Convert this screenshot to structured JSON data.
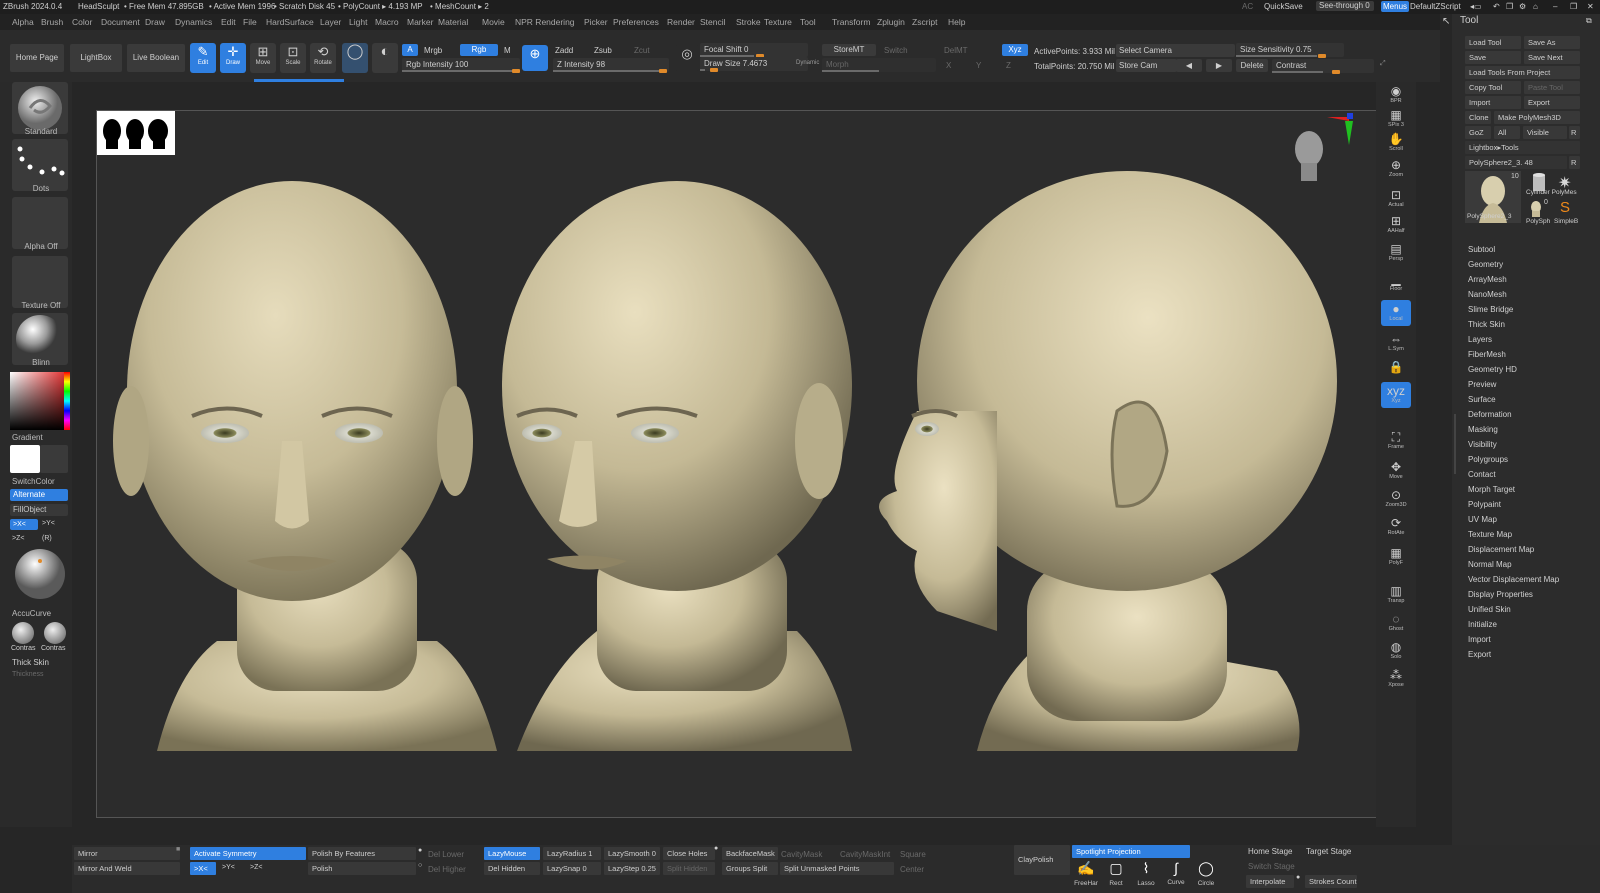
{
  "titlebar": {
    "app": "ZBrush 2024.0.4",
    "project": "HeadSculpt",
    "free_mem": "• Free Mem 47.895GB",
    "active_mem": "• Active Mem 1996",
    "scratch": "• Scratch Disk 45",
    "polycount": "• PolyCount ▸ 4.193 MP",
    "meshcount": "• MeshCount ▸ 2",
    "ac": "AC",
    "quicksave": "QuickSave",
    "seethrough": "See-through  0",
    "menus": "Menus",
    "script": "DefaultZScript"
  },
  "menubar": [
    "Alpha",
    "Brush",
    "Color",
    "Document",
    "Draw",
    "Dynamics",
    "Edit",
    "File",
    "HardSurface",
    "Layer",
    "Light",
    "Macro",
    "Marker",
    "Material",
    "Movie",
    "NPR Rendering",
    "Picker",
    "Preferences",
    "Render",
    "Stencil",
    "Stroke",
    "Texture",
    "Tool",
    "Transform",
    "Zplugin",
    "Zscript",
    "Help"
  ],
  "shelf": {
    "home_page": "Home Page",
    "lightbox": "LightBox",
    "live_boolean": "Live Boolean",
    "edit": "Edit",
    "draw": "Draw",
    "move": "Move",
    "scale": "Scale",
    "rotate": "Rotate",
    "a": "A",
    "mrgb": "Mrgb",
    "rgb": "Rgb",
    "m": "M",
    "rgb_intensity": "Rgb Intensity 100",
    "zadd": "Zadd",
    "zsub": "Zsub",
    "zcut": "Zcut",
    "z_intensity": "Z Intensity 98",
    "focal_shift": "Focal Shift 0",
    "draw_size": "Draw Size 7.4673",
    "dynamic": "Dynamic",
    "storemt": "StoreMT",
    "switch": "Switch",
    "delmt": "DelMT",
    "morph": "Morph",
    "xyz": "Xyz",
    "x": "X",
    "y": "Y",
    "z": "Z",
    "active_points": "ActivePoints: 3.933 Mil",
    "total_points": "TotalPoints: 20.750 Mil",
    "select_camera": "Select Camera",
    "store_cam": "Store Cam",
    "delete": "Delete",
    "size_sensitivity": "Size Sensitivity 0.75",
    "contrast": "Contrast"
  },
  "lefttray": {
    "standard": "Standard",
    "dots": "Dots",
    "alpha_off": "Alpha Off",
    "texture_off": "Texture Off",
    "blinn": "Blinn",
    "gradient": "Gradient",
    "switchcolor": "SwitchColor",
    "alternate": "Alternate",
    "fillobject": "FillObject",
    "xminus": ">X<",
    "yminus": ">Y<",
    "zminus": ">Z<",
    "r": "(R)",
    "accucurve": "AccuCurve",
    "contras1": "Contras",
    "contras2": "Contras",
    "thick_skin": "Thick Skin",
    "thickness": "Thickness"
  },
  "rightshelf": [
    {
      "icon": "bpr-icon",
      "label": "BPR"
    },
    {
      "icon": "spix-icon",
      "label": "SPix 3"
    },
    {
      "icon": "scroll-icon",
      "label": "Scroll"
    },
    {
      "icon": "zoom-icon",
      "label": "Zoom"
    },
    {
      "icon": "actual-icon",
      "label": "Actual"
    },
    {
      "icon": "aahalf-icon",
      "label": "AAHalf"
    },
    {
      "icon": "persp-icon",
      "label": "Persp"
    },
    {
      "icon": "floor-icon",
      "label": "Floor"
    },
    {
      "icon": "local-icon",
      "label": "Local"
    },
    {
      "icon": "lsym-icon",
      "label": "L.Sym"
    },
    {
      "icon": "lock-icon",
      "label": ""
    },
    {
      "icon": "xyz-icon",
      "label": "Xyz"
    },
    {
      "icon": "frame-icon",
      "label": "Frame"
    },
    {
      "icon": "move-icon",
      "label": "Move"
    },
    {
      "icon": "zoom3d-icon",
      "label": "Zoom3D"
    },
    {
      "icon": "rotate-icon",
      "label": "RotAte"
    },
    {
      "icon": "linefill-icon",
      "label": "PolyF"
    },
    {
      "icon": "transp-icon",
      "label": "Transp"
    },
    {
      "icon": "ghost-icon",
      "label": "Ghost"
    },
    {
      "icon": "solo-icon",
      "label": "Solo"
    },
    {
      "icon": "xpose-icon",
      "label": "Xpose"
    }
  ],
  "toolpanel": {
    "title": "Tool",
    "load_tool": "Load Tool",
    "save_as": "Save As",
    "save": "Save",
    "save_next": "Save Next",
    "load_tools_from_project": "Load Tools From Project",
    "copy_tool": "Copy Tool",
    "paste_tool": "Paste Tool",
    "import": "Import",
    "export": "Export",
    "clone": "Clone",
    "make_polymesh": "Make PolyMesh3D",
    "goz": "GoZ",
    "all": "All",
    "visible": "Visible",
    "r": "R",
    "lightbox_tools": "Lightbox▸Tools",
    "current_tool": "PolySphere2_3. 48",
    "thumb_count": "10",
    "thumb_main": "PolySphere2_3",
    "thumb_cyl": "Cylinder PolyMes",
    "thumb_small": "PolySph",
    "thumb_simple": "SimpleB",
    "thumb_zero": "0",
    "subpalettes": [
      "Subtool",
      "Geometry",
      "ArrayMesh",
      "NanoMesh",
      "Slime Bridge",
      "Thick Skin",
      "Layers",
      "FiberMesh",
      "Geometry HD",
      "Preview",
      "Surface",
      "Deformation",
      "Masking",
      "Visibility",
      "Polygroups",
      "Contact",
      "Morph Target",
      "Polypaint",
      "UV Map",
      "Texture Map",
      "Displacement Map",
      "Normal Map",
      "Vector Displacement Map",
      "Display Properties",
      "Unified Skin",
      "Initialize",
      "Import",
      "Export"
    ]
  },
  "bottombar": {
    "mirror": "Mirror",
    "mirror_weld": "Mirror And Weld",
    "activate_symmetry": "Activate Symmetry",
    "x": ">X<",
    "y": ">Y<",
    "z": ">Z<",
    "polish_features": "Polish By Features",
    "polish": "Polish",
    "del_lower": "Del Lower",
    "del_higher": "Del Higher",
    "lazymouse": "LazyMouse",
    "del_hidden": "Del Hidden",
    "lazyradius": "LazyRadius 1",
    "lazysnap": "LazySnap 0",
    "lazysmooth": "LazySmooth 0",
    "lazystep": "LazyStep 0.25",
    "close_holes": "Close Holes",
    "split_hidden": "Split Hidden",
    "backfacemask": "BackfaceMask",
    "groups_split": "Groups Split",
    "cavitymask": "CavityMask",
    "cavitymaskint": "CavityMaskInt",
    "square": "Square",
    "split_unmasked": "Split Unmasked Points",
    "center": "Center",
    "claypolish": "ClayPolish",
    "spotlight": "Spotlight Projection",
    "freehand": "FreeHar",
    "rect": "Rect",
    "lasso": "Lasso",
    "curve": "Curve",
    "circle": "Circle",
    "home_stage": "Home Stage",
    "target_stage": "Target Stage",
    "switch_stage": "Switch Stage",
    "interpolate": "Interpolate",
    "strokes_count": "Strokes Count"
  },
  "colors": {
    "accent": "#2f7fe0",
    "clay": "#c9bf9d",
    "background": "#262626"
  }
}
